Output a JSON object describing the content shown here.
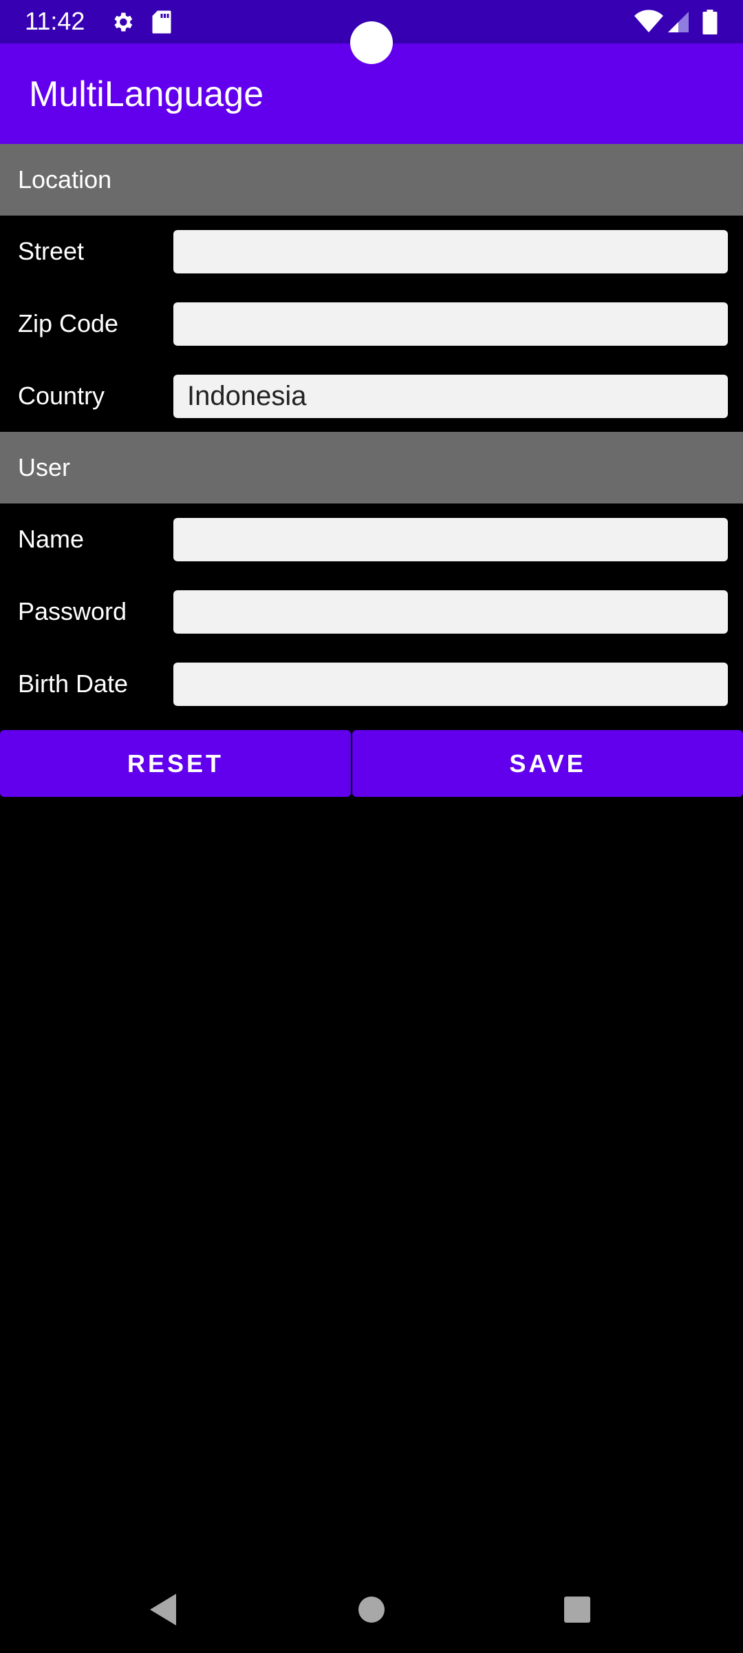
{
  "status_bar": {
    "time": "11:42",
    "icons": [
      "gear-icon",
      "sd-card-icon",
      "wifi-icon",
      "signal-icon",
      "battery-icon"
    ]
  },
  "app_bar": {
    "title": "MultiLanguage"
  },
  "sections": {
    "location": {
      "header": "Location",
      "fields": {
        "street": {
          "label": "Street",
          "value": ""
        },
        "zip": {
          "label": "Zip Code",
          "value": ""
        },
        "country": {
          "label": "Country",
          "value": "Indonesia"
        }
      }
    },
    "user": {
      "header": "User",
      "fields": {
        "name": {
          "label": "Name",
          "value": ""
        },
        "password": {
          "label": "Password",
          "value": ""
        },
        "birth_date": {
          "label": "Birth Date",
          "value": ""
        }
      }
    }
  },
  "buttons": {
    "reset": "RESET",
    "save": "SAVE"
  },
  "navigation": {
    "icons": [
      "back-icon",
      "home-icon",
      "recents-icon"
    ]
  },
  "colors": {
    "primary": "#6200ee",
    "primary_dark": "#3700b3",
    "section_header": "#6b6b6b",
    "input_bg": "#f2f2f2",
    "background": "#000000"
  }
}
